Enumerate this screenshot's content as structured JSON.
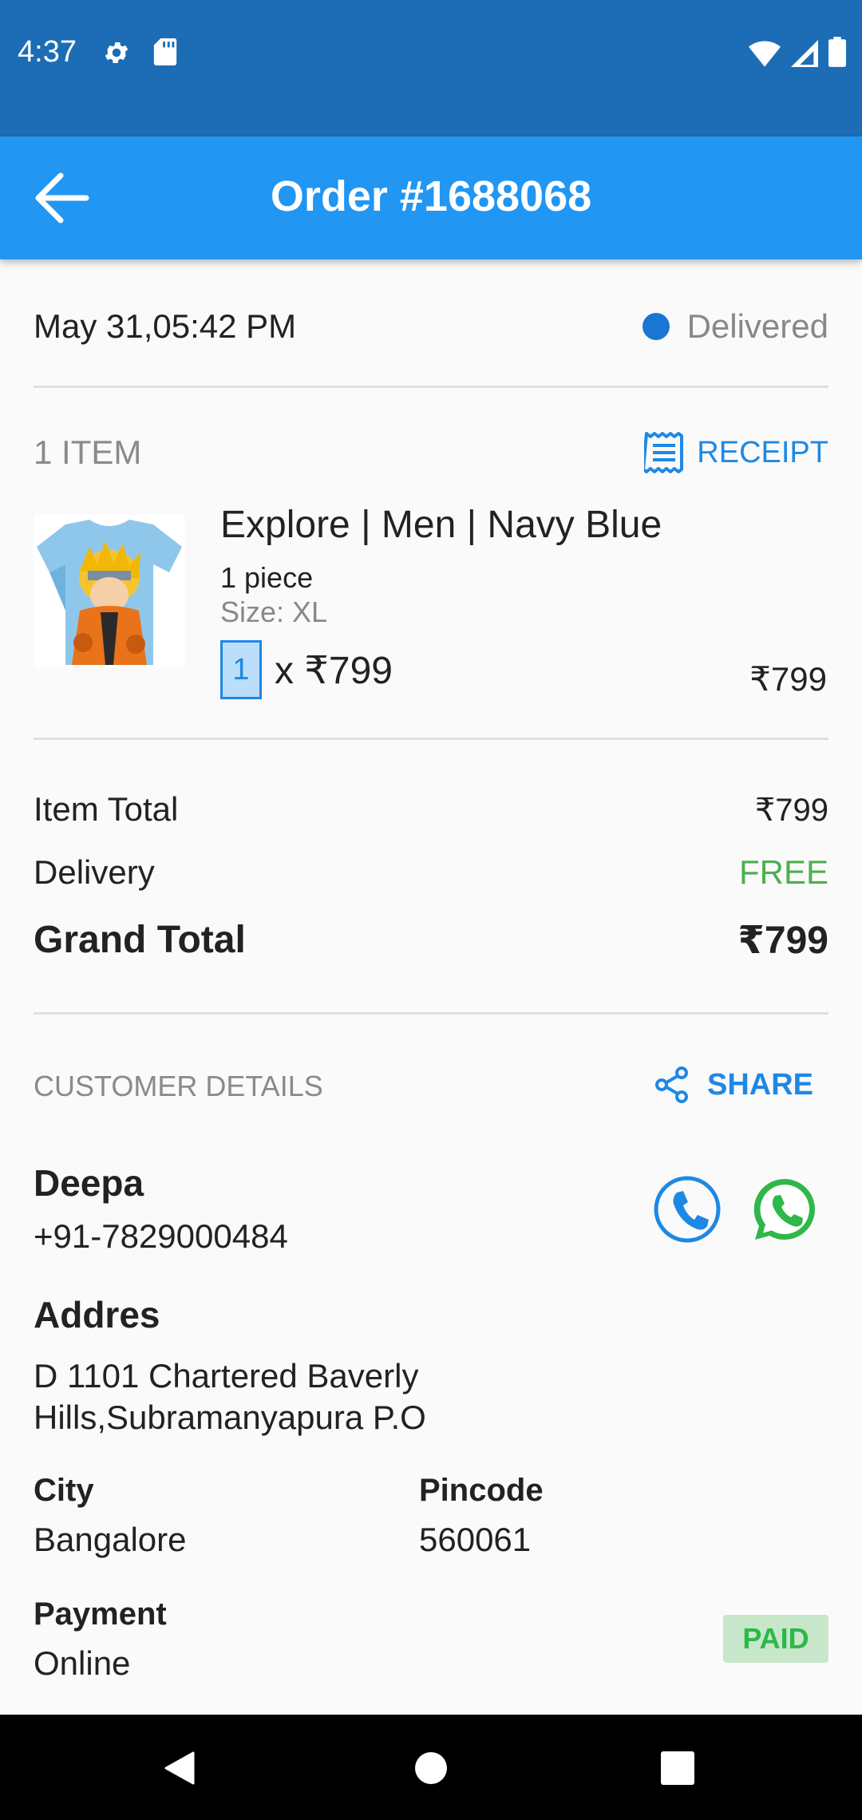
{
  "status_bar": {
    "time": "4:37",
    "icons": [
      "gear-icon",
      "sd-card-icon",
      "wifi-icon",
      "signal-icon",
      "battery-icon"
    ]
  },
  "app_bar": {
    "title": "Order #1688068",
    "back_icon": "arrow-left-icon"
  },
  "order": {
    "datetime": "May 31,05:42 PM",
    "status": "Delivered",
    "status_color": "#1976d2"
  },
  "items_section": {
    "count_label": "1 ITEM",
    "receipt_label": "RECEIPT",
    "items": [
      {
        "name": "Explore | Men | Navy Blue",
        "pieces": "1 piece",
        "size": "Size: XL",
        "quantity": "1",
        "unit_price": "x ₹799",
        "line_total": "₹799"
      }
    ]
  },
  "summary": {
    "item_total_label": "Item Total",
    "item_total_value": "₹799",
    "delivery_label": "Delivery",
    "delivery_value": "FREE",
    "grand_total_label": "Grand Total",
    "grand_total_value": "₹799"
  },
  "customer": {
    "section_label": "CUSTOMER DETAILS",
    "share_label": "SHARE",
    "name": "Deepa",
    "phone": "+91-7829000484",
    "address_label": "Addres",
    "address": "D 1101 Chartered Baverly Hills,Subramanyapura P.O",
    "city_label": "City",
    "city": "Bangalore",
    "pincode_label": "Pincode",
    "pincode": "560061",
    "payment_label": "Payment",
    "payment": "Online",
    "payment_status": "PAID"
  },
  "colors": {
    "primary": "#2196f3",
    "status_bar": "#1c6db5",
    "accent_link": "#1e88e5",
    "free_green": "#4caf50",
    "whatsapp_green": "#2eb84a"
  }
}
